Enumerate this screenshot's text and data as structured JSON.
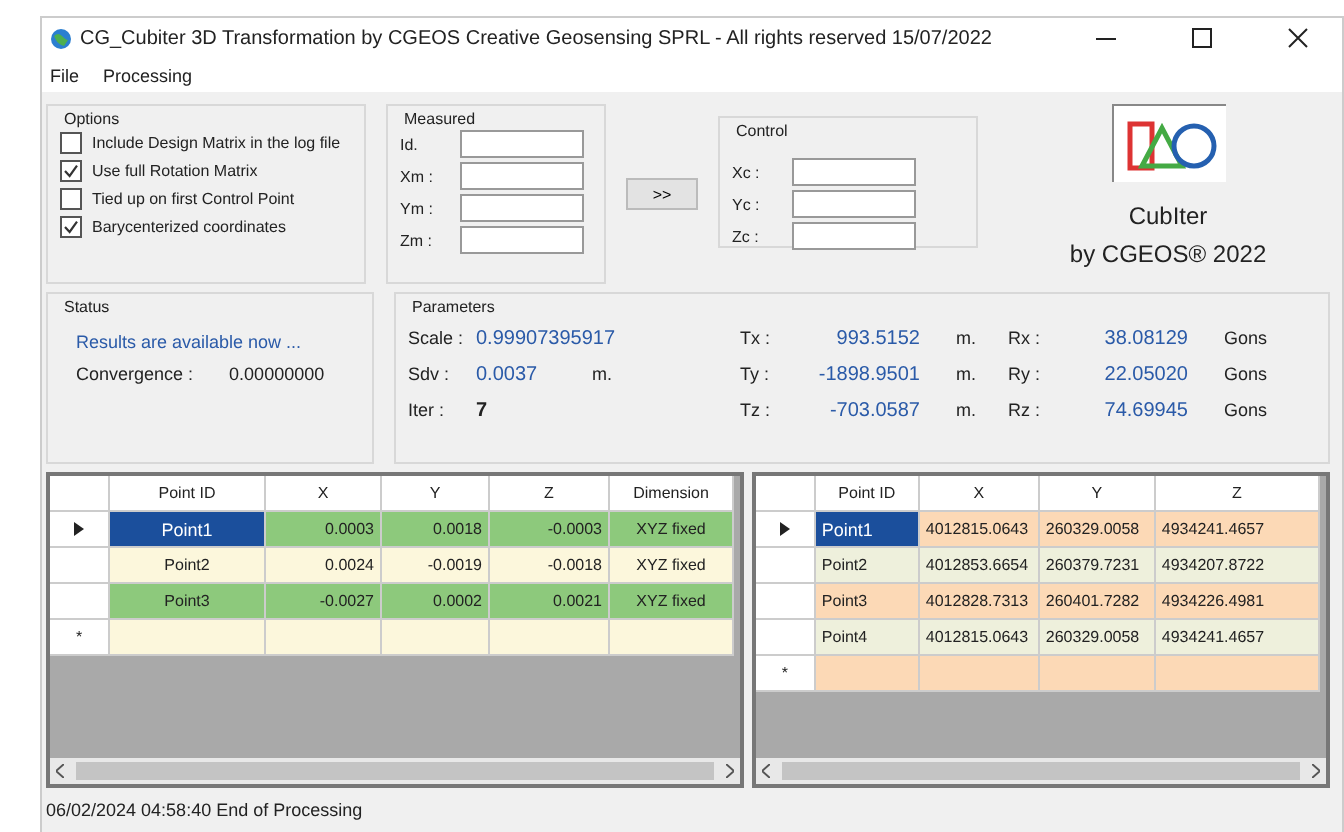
{
  "window": {
    "title": "CG_Cubiter 3D Transformation by CGEOS Creative Geosensing SPRL - All rights reserved 15/07/2022"
  },
  "menu": [
    "File",
    "Processing"
  ],
  "options": {
    "title": "Options",
    "items": [
      {
        "label": "Include Design Matrix in the log file",
        "checked": false
      },
      {
        "label": "Use full Rotation Matrix",
        "checked": true
      },
      {
        "label": "Tied up on first Control Point",
        "checked": false
      },
      {
        "label": "Barycenterized coordinates",
        "checked": true
      }
    ]
  },
  "measured": {
    "title": "Measured",
    "fields": [
      {
        "label": "Id."
      },
      {
        "label": "Xm :"
      },
      {
        "label": "Ym :"
      },
      {
        "label": "Zm :"
      }
    ]
  },
  "transfer_button": ">>",
  "control": {
    "title": "Control",
    "fields": [
      {
        "label": "Xc :"
      },
      {
        "label": "Yc :"
      },
      {
        "label": "Zc :"
      }
    ]
  },
  "logo": {
    "name": "CubIter",
    "subtitle": "by CGEOS® 2022"
  },
  "status": {
    "title": "Status",
    "message": "Results are available now ...",
    "convergence_label": "Convergence :",
    "convergence": "0.00000000"
  },
  "parameters": {
    "title": "Parameters",
    "columns": [
      [
        {
          "label": "Scale :",
          "value": "0.99907395917",
          "kind": "value"
        },
        {
          "label": "Sdv :",
          "value": "0.0037",
          "unit": "m.",
          "kind": "value"
        },
        {
          "label": "Iter :",
          "value": "7",
          "kind": "count"
        }
      ],
      [
        {
          "label": "Tx :",
          "value": "993.5152",
          "unit": "m.",
          "kind": "value"
        },
        {
          "label": "Ty :",
          "value": "-1898.9501",
          "unit": "m.",
          "kind": "value"
        },
        {
          "label": "Tz :",
          "value": "-703.0587",
          "unit": "m.",
          "kind": "value"
        }
      ],
      [
        {
          "label": "Rx :",
          "value": "38.08129",
          "unit": "Gons",
          "kind": "value"
        },
        {
          "label": "Ry :",
          "value": "22.05020",
          "unit": "Gons",
          "kind": "value"
        },
        {
          "label": "Rz :",
          "value": "74.69945",
          "unit": "Gons",
          "kind": "value"
        }
      ]
    ]
  },
  "residuals_table": {
    "columns": [
      "Point ID",
      "X",
      "Y",
      "Z",
      "Dimension"
    ],
    "rows": [
      {
        "kind": "data",
        "selected": true,
        "color": "#8dc97c",
        "cells": [
          "Point1",
          "0.0003",
          "0.0018",
          "-0.0003",
          "XYZ fixed"
        ]
      },
      {
        "kind": "data",
        "selected": false,
        "color": "#fcf7dc",
        "cells": [
          "Point2",
          "0.0024",
          "-0.0019",
          "-0.0018",
          "XYZ fixed"
        ]
      },
      {
        "kind": "data",
        "selected": false,
        "color": "#8dc97c",
        "cells": [
          "Point3",
          "-0.0027",
          "0.0002",
          "0.0021",
          "XYZ fixed"
        ]
      },
      {
        "kind": "new",
        "marker": "*",
        "color": "#fcf7dc"
      }
    ]
  },
  "control_table": {
    "columns": [
      "Point ID",
      "X",
      "Y",
      "Z"
    ],
    "rows": [
      {
        "kind": "data",
        "selected": true,
        "color": "#fcd9b6",
        "cells": [
          "Point1",
          "4012815.0643",
          "260329.0058",
          "4934241.4657"
        ]
      },
      {
        "kind": "data",
        "selected": false,
        "color": "#eef0dc",
        "cells": [
          "Point2",
          "4012853.6654",
          "260379.7231",
          "4934207.8722"
        ]
      },
      {
        "kind": "data",
        "selected": false,
        "color": "#fcd9b6",
        "cells": [
          "Point3",
          "4012828.7313",
          "260401.7282",
          "4934226.4981"
        ]
      },
      {
        "kind": "data",
        "selected": false,
        "color": "#eef0dc",
        "cells": [
          "Point4",
          "4012815.0643",
          "260329.0058",
          "4934241.4657"
        ]
      },
      {
        "kind": "new",
        "marker": "*",
        "color": "#fcd9b6"
      }
    ]
  },
  "status_bar": "06/02/2024  04:58:40  End of Processing"
}
